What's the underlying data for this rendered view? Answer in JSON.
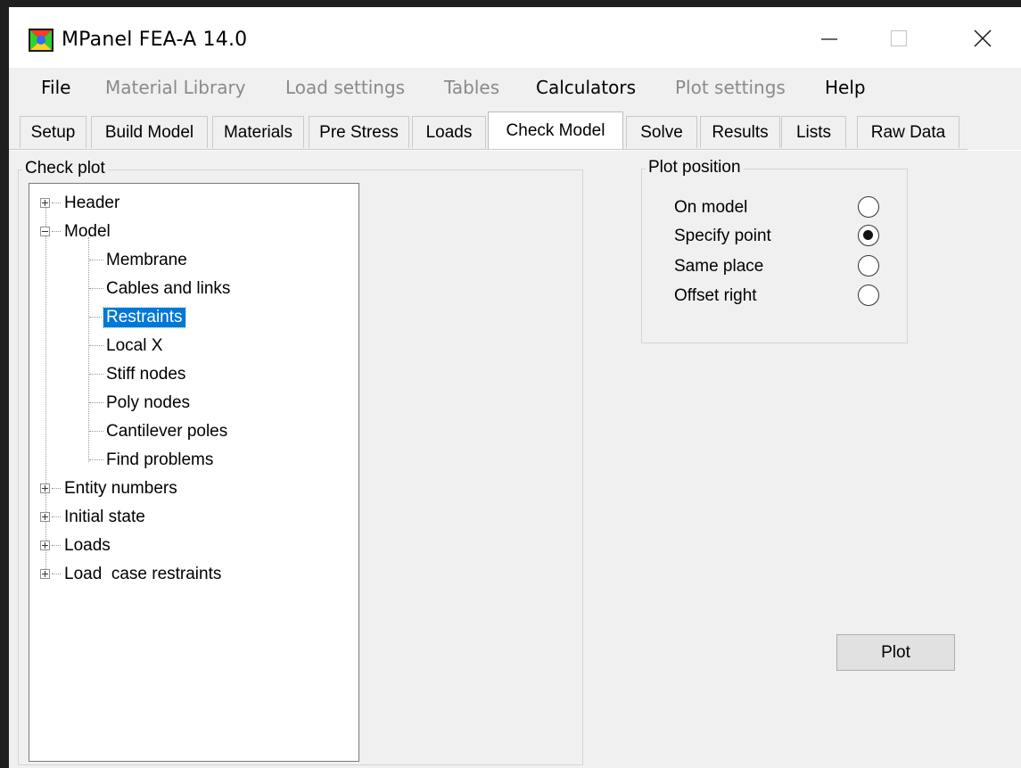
{
  "window": {
    "title": "MPanel FEA-A 14.0"
  },
  "menu": [
    {
      "label": "File",
      "enabled": true
    },
    {
      "label": "Material Library",
      "enabled": false
    },
    {
      "label": "Load settings",
      "enabled": false
    },
    {
      "label": "Tables",
      "enabled": false
    },
    {
      "label": "Calculators",
      "enabled": true
    },
    {
      "label": "Plot settings",
      "enabled": false
    },
    {
      "label": "Help",
      "enabled": true
    }
  ],
  "tabs": [
    {
      "label": "Setup",
      "active": false
    },
    {
      "label": "Build Model",
      "active": false
    },
    {
      "label": "Materials",
      "active": false
    },
    {
      "label": "Pre Stress",
      "active": false
    },
    {
      "label": "Loads",
      "active": false
    },
    {
      "label": "Check Model",
      "active": true
    },
    {
      "label": "Solve",
      "active": false
    },
    {
      "label": "Results",
      "active": false
    },
    {
      "label": "Lists",
      "active": false
    },
    {
      "label": "Raw Data",
      "active": false
    }
  ],
  "check_plot": {
    "legend": "Check plot",
    "tree": [
      {
        "label": "Header",
        "expanded": false
      },
      {
        "label": "Model",
        "expanded": true,
        "children": [
          {
            "label": "Membrane"
          },
          {
            "label": "Cables and links"
          },
          {
            "label": "Restraints",
            "selected": true
          },
          {
            "label": "Local X"
          },
          {
            "label": "Stiff nodes"
          },
          {
            "label": "Poly nodes"
          },
          {
            "label": "Cantilever poles"
          },
          {
            "label": "Find problems"
          }
        ]
      },
      {
        "label": "Entity numbers",
        "expanded": false
      },
      {
        "label": "Initial state",
        "expanded": false
      },
      {
        "label": "Loads",
        "expanded": false
      },
      {
        "label": "Load  case restraints",
        "expanded": false
      }
    ]
  },
  "plot_position": {
    "legend": "Plot position",
    "options": [
      {
        "label": "On model",
        "checked": false
      },
      {
        "label": "Specify point",
        "checked": true
      },
      {
        "label": "Same place",
        "checked": false
      },
      {
        "label": "Offset right",
        "checked": false
      }
    ],
    "selected": "Specify point"
  },
  "plot_button": {
    "label": "Plot"
  }
}
